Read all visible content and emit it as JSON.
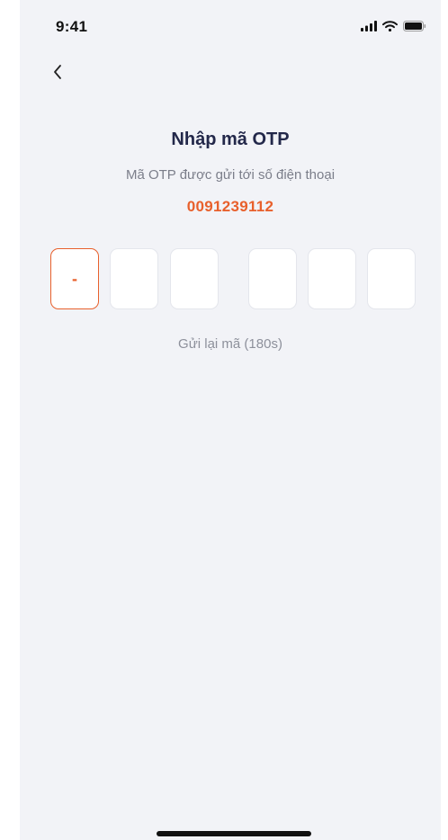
{
  "status_bar": {
    "time": "9:41",
    "icons": [
      "signal-icon",
      "wifi-icon",
      "battery-icon"
    ]
  },
  "nav": {
    "back_icon": "chevron-left-icon"
  },
  "otp": {
    "title": "Nhập mã OTP",
    "subtitle": "Mã OTP được gửi tới số điện thoại",
    "phone_number": "0091239112",
    "digits": [
      "-",
      "",
      "",
      "",
      "",
      ""
    ],
    "resend_label": "Gửi lại mã (180s)"
  },
  "colors": {
    "accent": "#e8602c",
    "title": "#23284a",
    "background": "#f2f3f7",
    "muted_text": "#7b7e8a"
  }
}
